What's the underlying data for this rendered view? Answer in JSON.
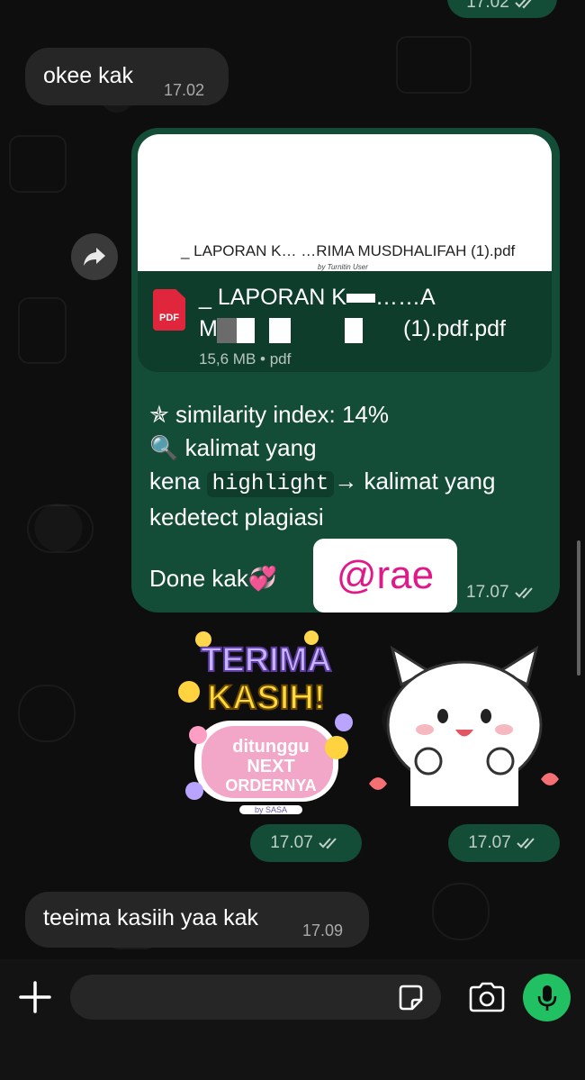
{
  "messages": {
    "top_partial": {
      "time": "17.02"
    },
    "okee": {
      "text": "okee kak",
      "time": "17.02"
    },
    "document": {
      "preview_title": "_ LAPORAN K… …RIMA MUSDHALIFAH (1).pdf",
      "preview_by": "by Turnitin User",
      "pdf_label": "PDF",
      "filename_line1": "_ LAPORAN K",
      "filename_line1_tail": "……A",
      "filename_line2_start": "M",
      "filename_line2_end": "(1).pdf.pdf",
      "meta": "15,6 MB • pdf",
      "caption_line1": "✯  similarity index: 14%",
      "caption_line2": "🔍 kalimat yang",
      "caption_line3_pre": "kena ",
      "caption_code": "highlight",
      "caption_line3_post": "→ kalimat yang",
      "caption_line4": "kedetect plagiasi",
      "done": "Done kak💞",
      "watermark": "@rae",
      "time": "17.07"
    },
    "sticker1": {
      "line1": "TERIMA",
      "line2": "KASIH!",
      "line3": "ditunggu",
      "line4": "NEXT",
      "line5": "ORDERNYA",
      "by": "by SASA",
      "time": "17.07"
    },
    "sticker2": {
      "time": "17.07"
    },
    "teeima": {
      "text": "teeima kasiih yaa kak",
      "time": "17.09"
    }
  },
  "input": {
    "placeholder": ""
  },
  "icons": {
    "forward": "forward-arrow-icon",
    "plus": "plus-icon",
    "sticker": "sticker-icon",
    "camera": "camera-icon",
    "mic": "microphone-icon",
    "ticks": "double-check-icon"
  },
  "colors": {
    "outgoing_bubble": "#144d37",
    "incoming_bubble": "#262626",
    "mic_button": "#21c063",
    "watermark_text": "#e0198a"
  }
}
